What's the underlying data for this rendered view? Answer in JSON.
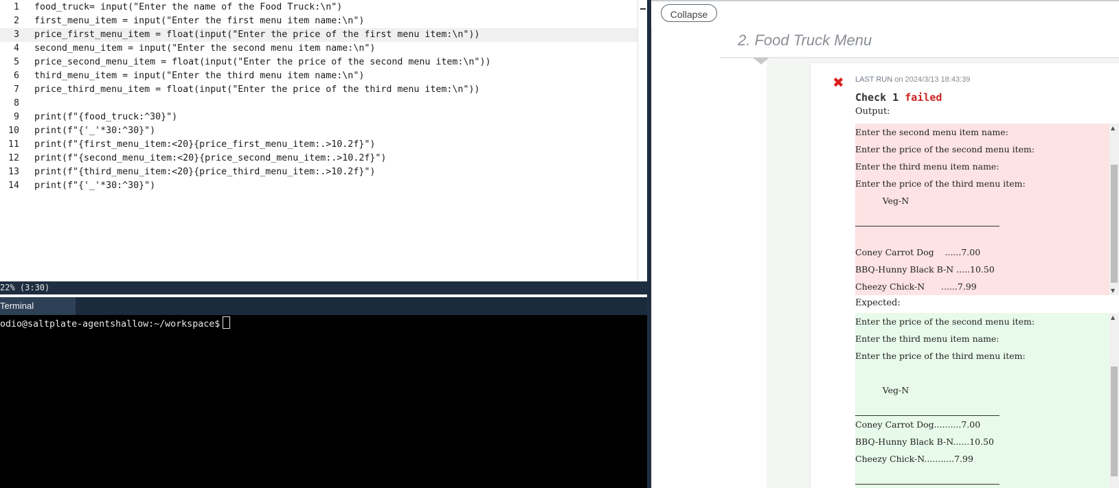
{
  "editor": {
    "active_line": 3,
    "lines": [
      {
        "num": "1",
        "code": "food_truck= input(\"Enter the name of the Food Truck:\\n\")"
      },
      {
        "num": "2",
        "code": "first_menu_item = input(\"Enter the first menu item name:\\n\")"
      },
      {
        "num": "3",
        "code": "price_first_menu_item = float(input(\"Enter the price of the first menu item:\\n\"))"
      },
      {
        "num": "4",
        "code": "second_menu_item = input(\"Enter the second menu item name:\\n\")"
      },
      {
        "num": "5",
        "code": "price_second_menu_item = float(input(\"Enter the price of the second menu item:\\n\"))"
      },
      {
        "num": "6",
        "code": "third_menu_item = input(\"Enter the third menu item name:\\n\")"
      },
      {
        "num": "7",
        "code": "price_third_menu_item = float(input(\"Enter the price of the third menu item:\\n\"))"
      },
      {
        "num": "8",
        "code": ""
      },
      {
        "num": "9",
        "code": "print(f\"{food_truck:^30}\")"
      },
      {
        "num": "10",
        "code": "print(f\"{'_'*30:^30}\")"
      },
      {
        "num": "11",
        "code": "print(f\"{first_menu_item:<20}{price_first_menu_item:.>10.2f}\")"
      },
      {
        "num": "12",
        "code": "print(f\"{second_menu_item:<20}{price_second_menu_item:.>10.2f}\")"
      },
      {
        "num": "13",
        "code": "print(f\"{third_menu_item:<20}{price_third_menu_item:.>10.2f}\")"
      },
      {
        "num": "14",
        "code": "print(f\"{'_'*30:^30}\")"
      }
    ]
  },
  "statusbar": {
    "text": "22% (3:30)"
  },
  "terminal": {
    "tab_label": "Terminal",
    "prompt": "odio@saltplate-agentshallow:~/workspace$"
  },
  "right": {
    "collapse_label": "Collapse",
    "section_title": "2. Food Truck Menu",
    "last_run_label": "LAST RUN",
    "last_run_time": "on 2024/3/13 18:43:39",
    "check_prefix": "Check 1",
    "check_status": "failed",
    "output_label": "Output:",
    "expected_label": "Expected:",
    "output_lines": [
      "Enter the second menu item name:",
      "Enter the price of the second menu item:",
      "Enter the third menu item name:",
      "Enter the price of the third menu item:",
      "          Veg-N",
      "",
      "",
      "Coney Carrot Dog    ......7.00",
      "BBQ-Hunny Black B-N .....10.50",
      "Cheezy Chick-N      ......7.99",
      ""
    ],
    "expected_lines": [
      "Enter the price of the second menu item:",
      "Enter the third menu item name:",
      "Enter the price of the third menu item:",
      "",
      "          Veg-N",
      "",
      "Coney Carrot Dog..........7.00",
      "BBQ-Hunny Black B-N......10.50",
      "Cheezy Chick-N...........7.99",
      ""
    ]
  }
}
